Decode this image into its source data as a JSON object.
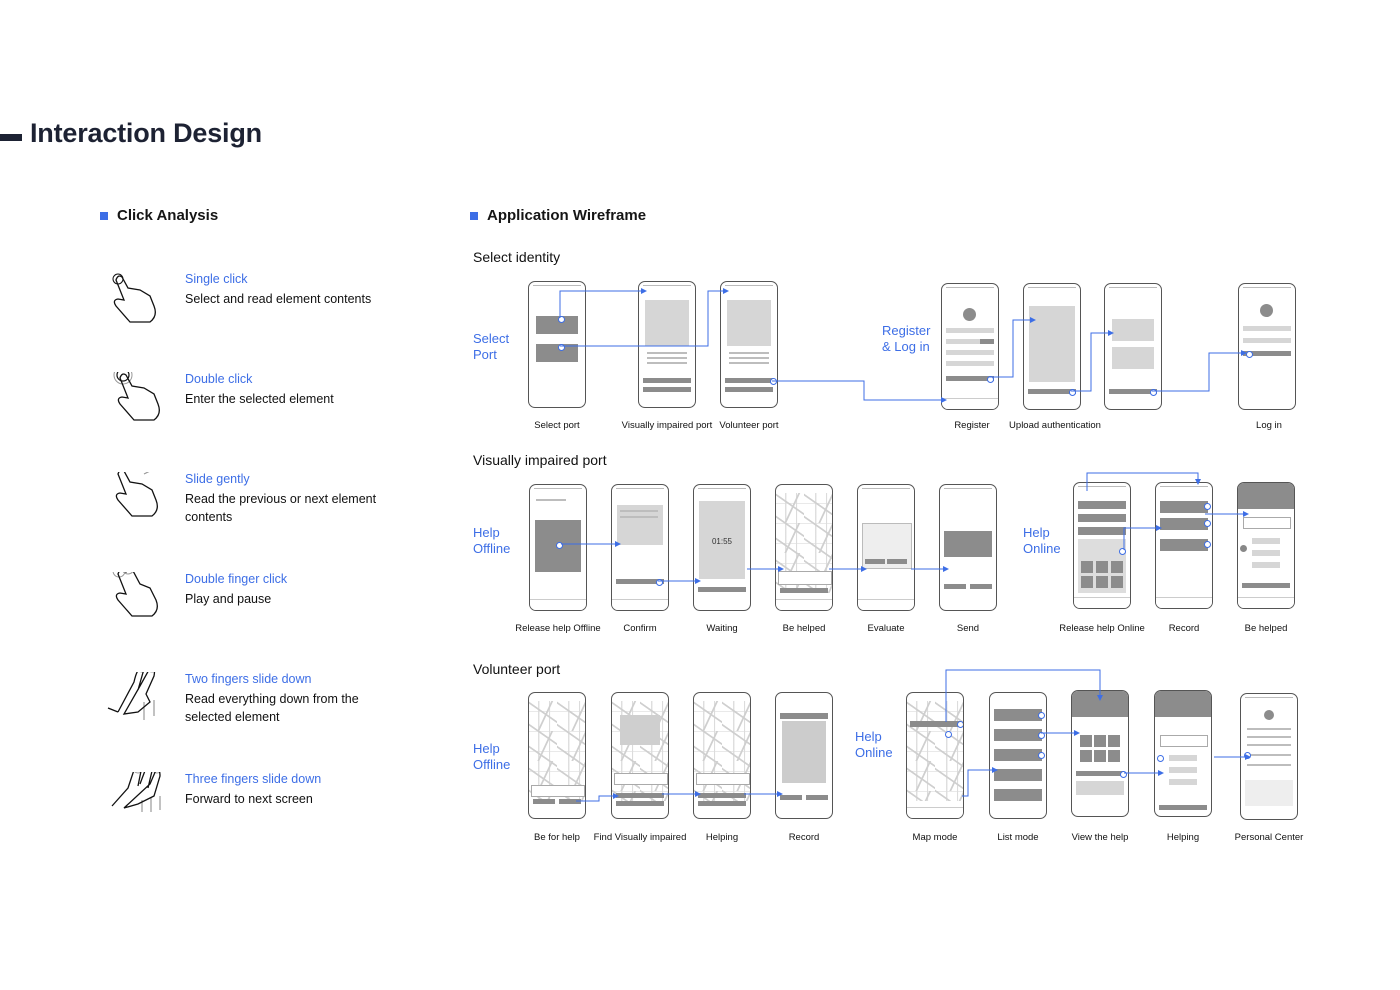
{
  "header": {
    "title": "Interaction Design"
  },
  "colors": {
    "accent": "#3d6ee6",
    "title": "#1d2233",
    "wire_dark": "#8c8c8c",
    "wire_light": "#d6d6d6"
  },
  "click_analysis": {
    "title": "Click Analysis",
    "gestures": [
      {
        "icon": "single-click-hand-icon",
        "name": "Single click",
        "desc": "Select and read element contents"
      },
      {
        "icon": "double-click-hand-icon",
        "name": "Double click",
        "desc": "Enter the selected element"
      },
      {
        "icon": "slide-gently-hand-icon",
        "name": "Slide gently",
        "desc": "Read the previous or next element contents"
      },
      {
        "icon": "double-finger-click-hand-icon",
        "name": "Double finger click",
        "desc": "Play and pause"
      },
      {
        "icon": "two-fingers-slide-hand-icon",
        "name": "Two fingers slide down",
        "desc": "Read everything down from the selected element"
      },
      {
        "icon": "three-fingers-slide-hand-icon",
        "name": "Three fingers slide down",
        "desc": "Forward to next screen"
      }
    ]
  },
  "wireframe": {
    "title": "Application Wireframe",
    "rows": [
      {
        "title": "Select identity",
        "groups": [
          {
            "label": "Select Port"
          },
          {
            "label": "Register & Log in"
          }
        ],
        "screens": [
          "Select port",
          "Visually impaired port",
          "Volunteer port",
          "Register",
          "Upload authentication",
          "Log in"
        ]
      },
      {
        "title": "Visually impaired port",
        "groups": [
          {
            "label": "Help Offline"
          },
          {
            "label": "Help Online"
          }
        ],
        "screens": [
          "Release help Offline",
          "Confirm",
          "Waiting",
          "Be helped",
          "Evaluate",
          "Send",
          "Release help Online",
          "Record",
          "Be helped"
        ]
      },
      {
        "title": "Volunteer port",
        "groups": [
          {
            "label": "Help Offline"
          },
          {
            "label": "Help Online"
          }
        ],
        "screens": [
          "Be for help",
          "Find Visually impaired",
          "Helping",
          "Record",
          "Map mode",
          "List mode",
          "View the help",
          "Helping",
          "Personal Center"
        ]
      }
    ],
    "timer": "01:55"
  }
}
